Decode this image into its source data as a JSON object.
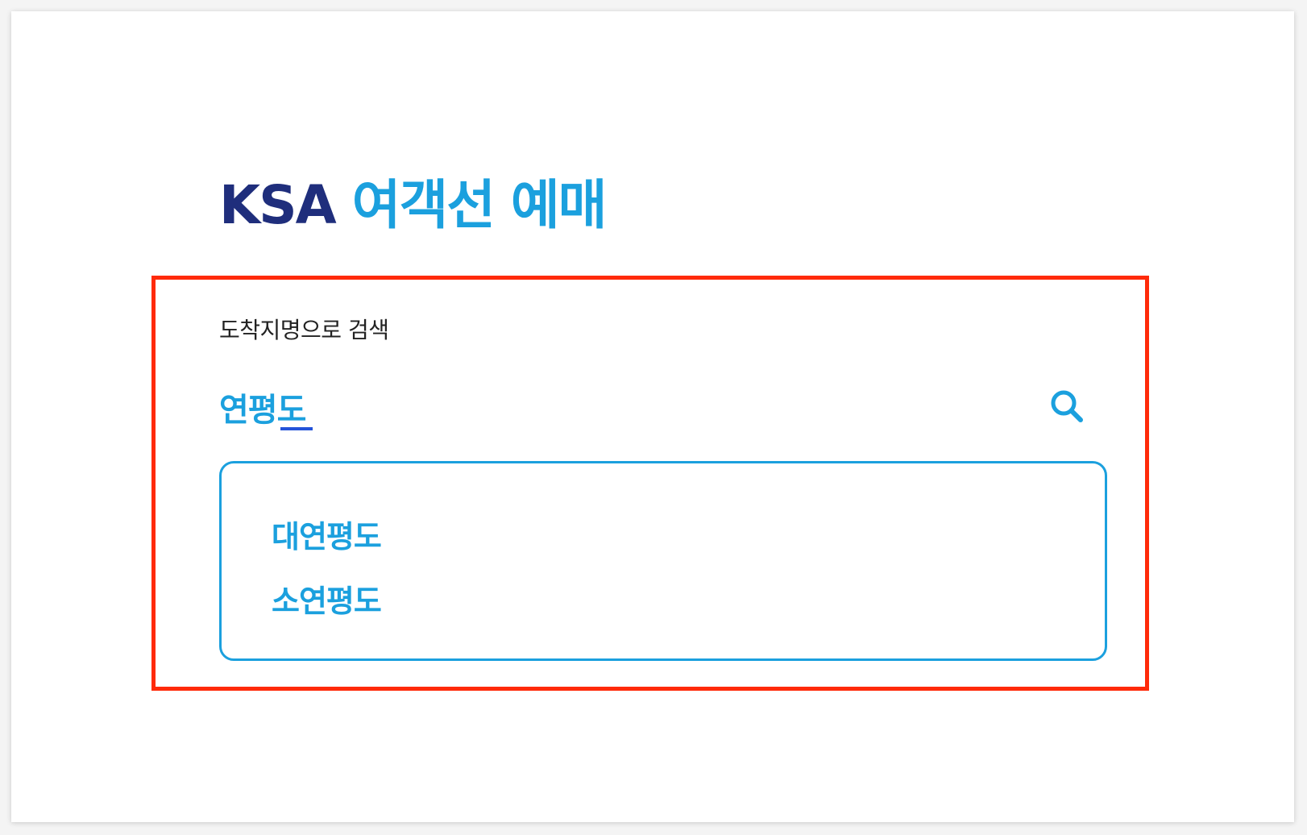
{
  "header": {
    "brand": "KSA",
    "service_title": "여객선 예매"
  },
  "search": {
    "label": "도착지명으로 검색",
    "value": "연평도",
    "icon": "search-icon"
  },
  "suggestions": [
    {
      "label": "대연평도"
    },
    {
      "label": "소연평도"
    }
  ],
  "colors": {
    "brand_navy": "#1f2e7c",
    "accent_blue": "#1ba0de",
    "highlight_red": "#ff2a0a"
  }
}
